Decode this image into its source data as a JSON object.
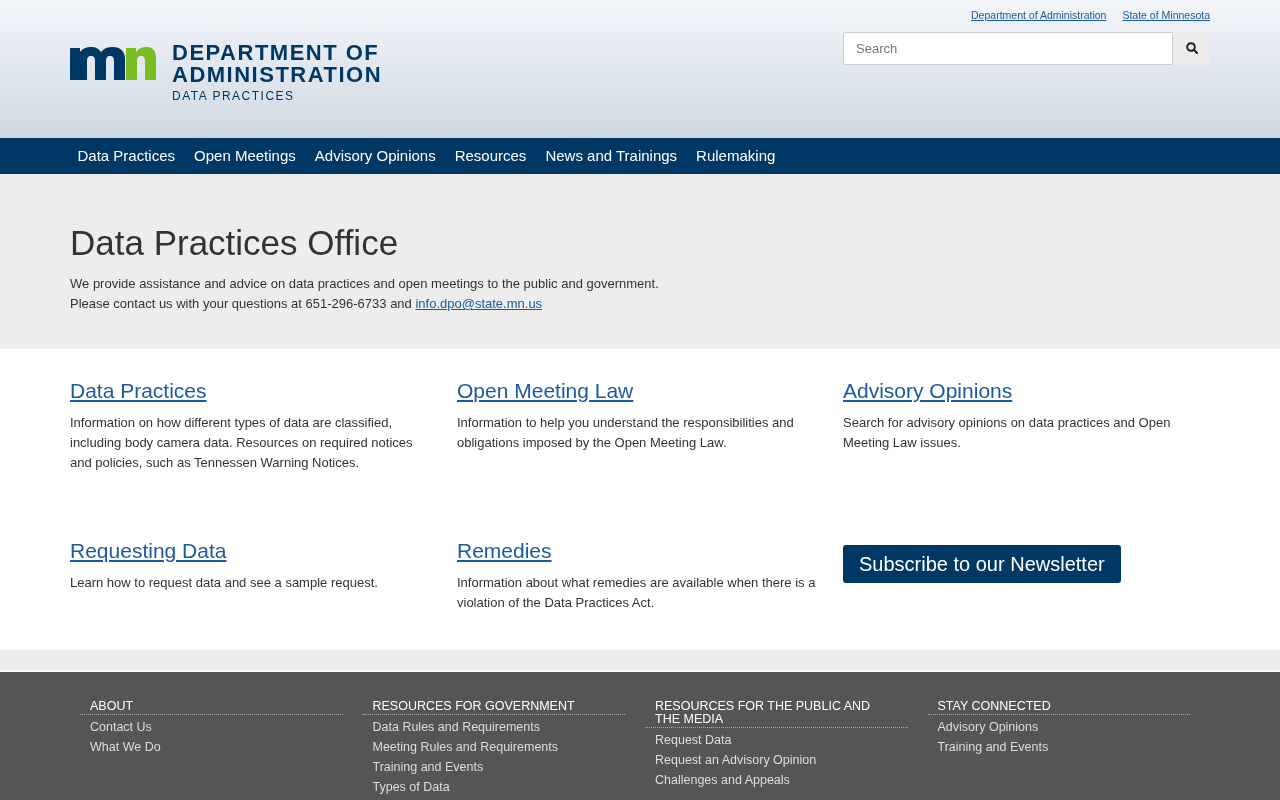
{
  "top_links": [
    "Department of Administration",
    "State of Minnesota"
  ],
  "logo": {
    "line_1": "DEPARTMENT OF",
    "line_2": "ADMINISTRATION",
    "line_3": "DATA PRACTICES"
  },
  "search": {
    "placeholder": "Search"
  },
  "nav": [
    "Data Practices",
    "Open Meetings",
    "Advisory Opinions",
    "Resources",
    "News and Trainings",
    "Rulemaking"
  ],
  "hero": {
    "title": "Data Practices Office",
    "line_1": "We provide assistance and advice on data practices and open meetings to the public and government.",
    "line_2": "Please contact us with your questions at 651-296-6733 and",
    "email": "info.dpo@state.mn.us"
  },
  "cards": [
    {
      "kind": "link",
      "title": "Data Practices",
      "text": "Information on how different types of data are classified, including body camera data. Resources on required notices and policies, such as Tennessen Warning Notices."
    },
    {
      "kind": "link",
      "title": "Open Meeting Law",
      "text": "Information to help you understand the responsibilities and obligations imposed by the Open Meeting Law."
    },
    {
      "kind": "link",
      "title": "Advisory Opinions",
      "text": "Search for advisory opinions on data practices and Open Meeting Law issues."
    },
    {
      "kind": "link",
      "title": "Requesting Data",
      "text": "Learn how to request data and see a sample request."
    },
    {
      "kind": "link",
      "title": "Remedies",
      "text": "Information about what remedies are available when there is a violation of the Data Practices Act."
    },
    {
      "kind": "button",
      "title": "Subscribe to our Newsletter"
    }
  ],
  "footer": [
    {
      "heading": "ABOUT",
      "links": [
        "Contact Us",
        "What We Do"
      ]
    },
    {
      "heading": "RESOURCES FOR GOVERNMENT",
      "links": [
        "Data Rules and Requirements",
        "Meeting Rules and Requirements",
        "Training and Events",
        "Types of Data"
      ]
    },
    {
      "heading": "RESOURCES FOR THE PUBLIC AND THE MEDIA",
      "links": [
        "Request Data",
        "Request an Advisory Opinion",
        "Challenges and Appeals"
      ]
    },
    {
      "heading": "STAY CONNECTED",
      "links": [
        "Advisory Opinions",
        "Training and Events"
      ]
    }
  ]
}
